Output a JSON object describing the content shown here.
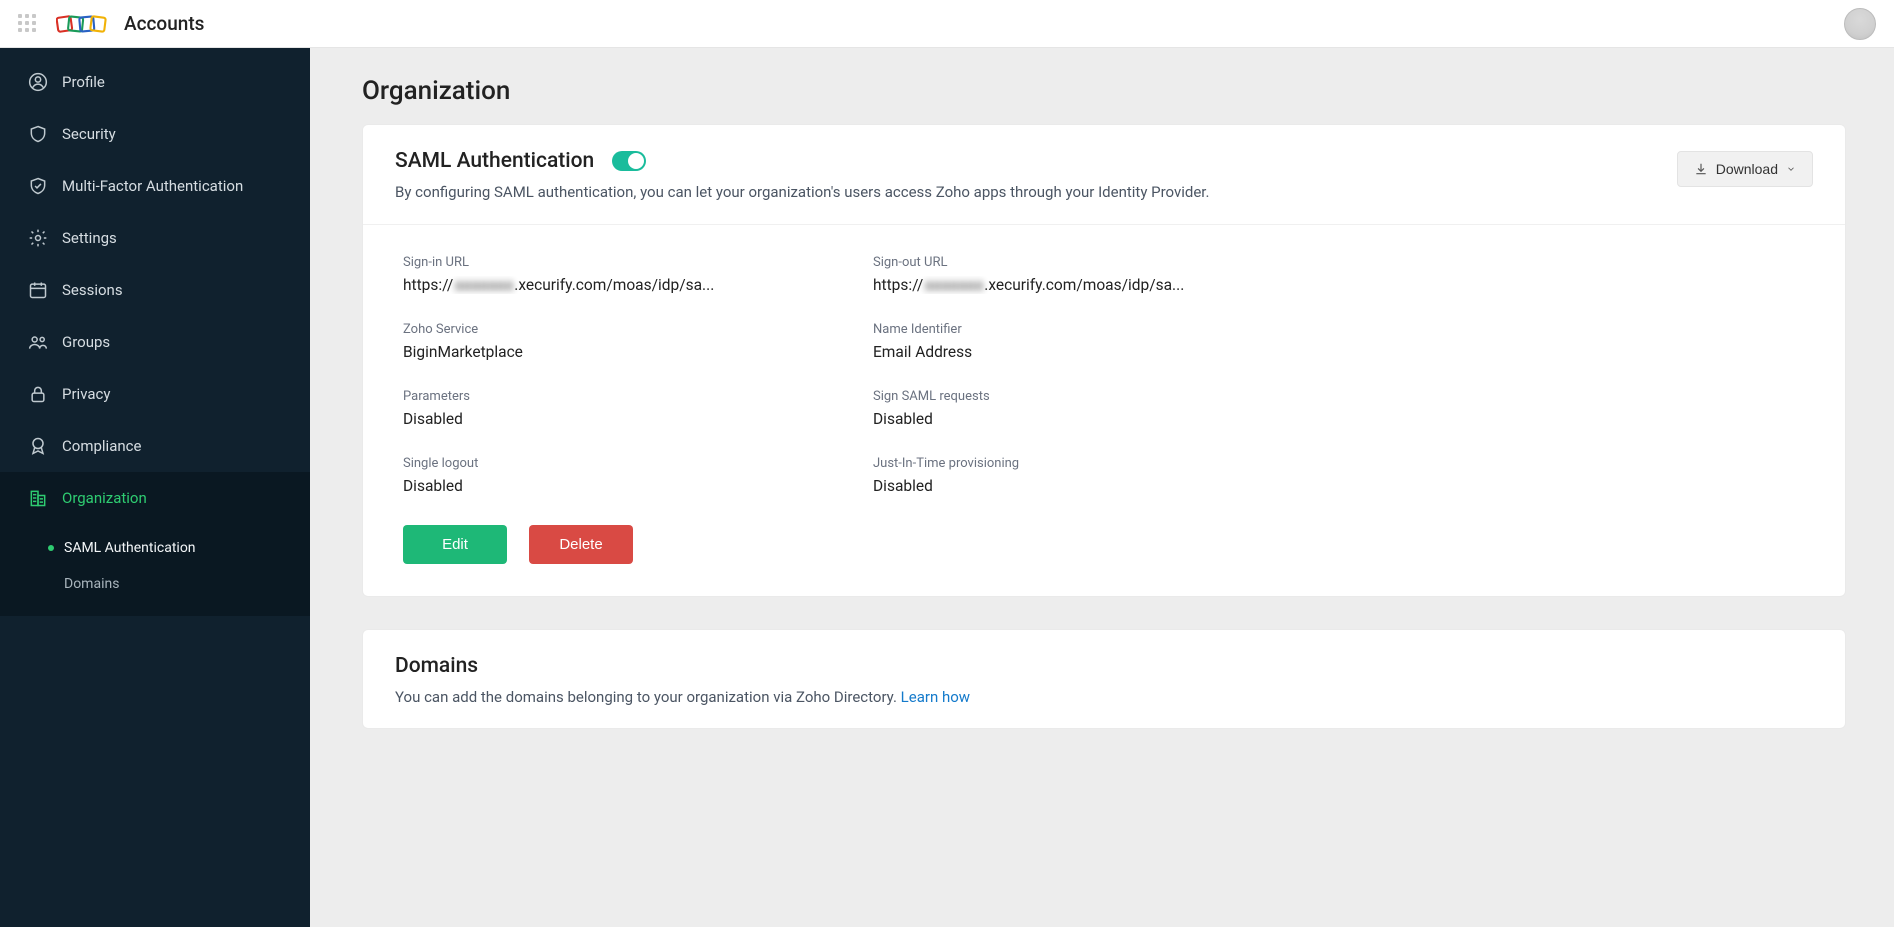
{
  "header": {
    "app_name": "Accounts"
  },
  "sidebar": {
    "items": [
      {
        "label": "Profile"
      },
      {
        "label": "Security"
      },
      {
        "label": "Multi-Factor Authentication"
      },
      {
        "label": "Settings"
      },
      {
        "label": "Sessions"
      },
      {
        "label": "Groups"
      },
      {
        "label": "Privacy"
      },
      {
        "label": "Compliance"
      },
      {
        "label": "Organization"
      }
    ],
    "organization_subitems": [
      {
        "label": "SAML Authentication"
      },
      {
        "label": "Domains"
      }
    ]
  },
  "page": {
    "title": "Organization"
  },
  "saml": {
    "title": "SAML Authentication",
    "description": "By configuring SAML authentication, you can let your organization's users access Zoho apps through your Identity Provider.",
    "download_label": "Download",
    "edit_label": "Edit",
    "delete_label": "Delete",
    "fields": {
      "signin_url_label": "Sign-in URL",
      "signin_url_pre": "https://",
      "signin_url_blur": "aaaaaaa",
      "signin_url_post": ".xecurify.com/moas/idp/sa...",
      "signout_url_label": "Sign-out URL",
      "signout_url_pre": "https://",
      "signout_url_blur": "aaaaaaa",
      "signout_url_post": ".xecurify.com/moas/idp/sa...",
      "zoho_service_label": "Zoho Service",
      "zoho_service_value": "BiginMarketplace",
      "name_identifier_label": "Name Identifier",
      "name_identifier_value": "Email Address",
      "parameters_label": "Parameters",
      "parameters_value": "Disabled",
      "sign_requests_label": "Sign SAML requests",
      "sign_requests_value": "Disabled",
      "single_logout_label": "Single logout",
      "single_logout_value": "Disabled",
      "jit_label": "Just-In-Time provisioning",
      "jit_value": "Disabled"
    }
  },
  "domains": {
    "title": "Domains",
    "description_pre": "You can add the domains belonging to your organization via Zoho Directory. ",
    "learn_how": "Learn how"
  }
}
